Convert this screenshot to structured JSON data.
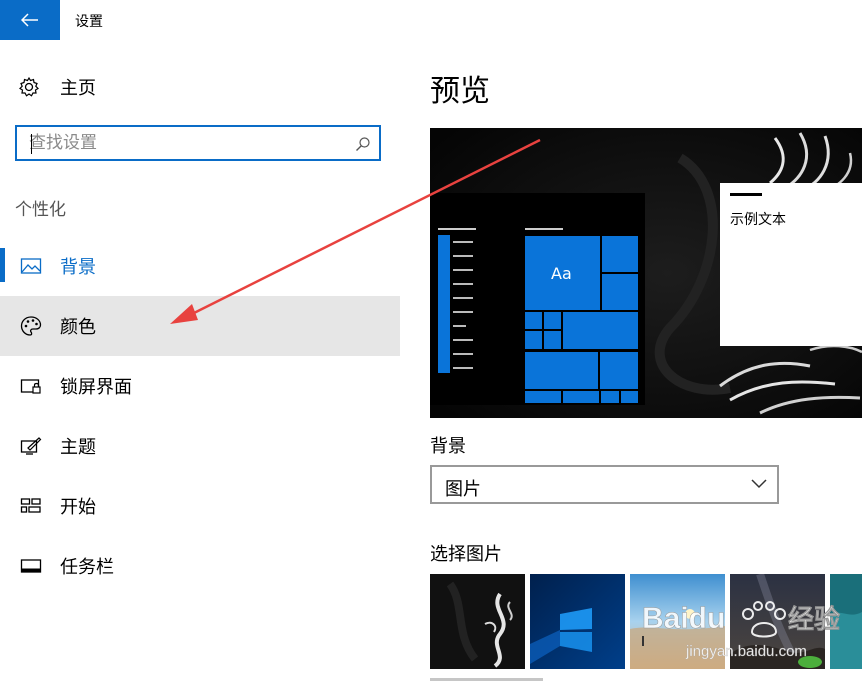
{
  "window": {
    "title": "设置"
  },
  "sidebar": {
    "home_label": "主页",
    "search_placeholder": "查找设置",
    "section_title": "个性化",
    "items": [
      {
        "label": "背景",
        "icon": "picture-icon",
        "selected": true
      },
      {
        "label": "颜色",
        "icon": "palette-icon",
        "hovered": true
      },
      {
        "label": "锁屏界面",
        "icon": "lock-screen-icon"
      },
      {
        "label": "主题",
        "icon": "theme-icon"
      },
      {
        "label": "开始",
        "icon": "start-icon"
      },
      {
        "label": "任务栏",
        "icon": "taskbar-icon"
      }
    ]
  },
  "main": {
    "title": "预览",
    "preview": {
      "tile_label": "Aa",
      "sample_text": "示例文本"
    },
    "background_label": "背景",
    "background_value": "图片",
    "choose_picture_label": "选择图片",
    "thumbnails": [
      "dragon-wallpaper",
      "windows-10-blue",
      "beach-sunset",
      "night-sky-rocks",
      "teal-ocean"
    ]
  },
  "watermark": {
    "brand": "Baidu",
    "brand_suffix": "经验",
    "url": "jingyan.baidu.com"
  },
  "colors": {
    "accent": "#0a6cc7",
    "hover": "#e6e6e6",
    "annotation_arrow": "#e8423f"
  }
}
